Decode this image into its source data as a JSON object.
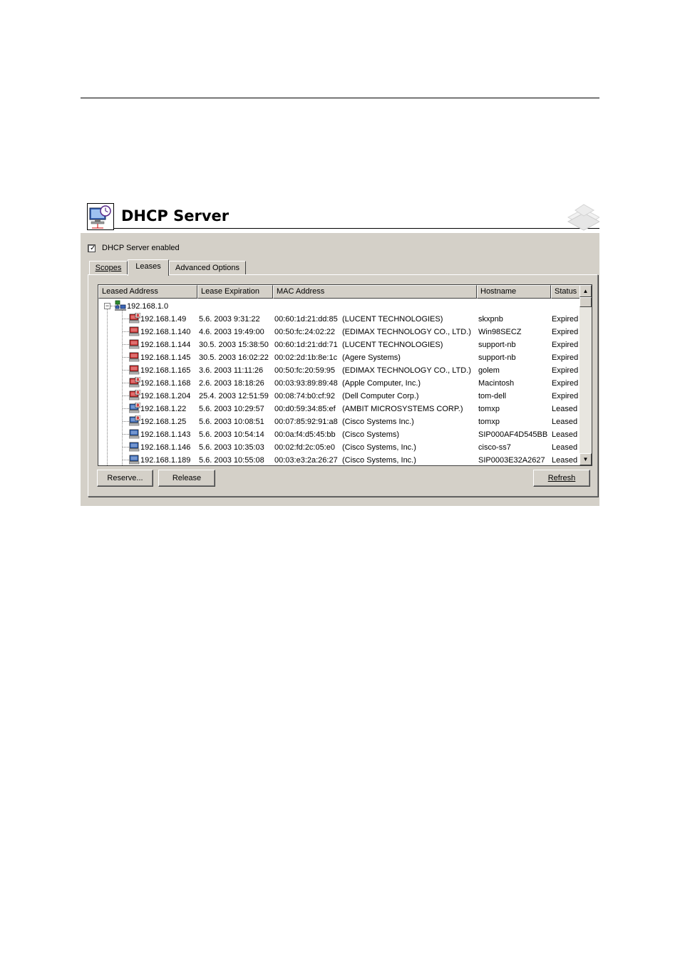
{
  "window": {
    "title": "DHCP Server"
  },
  "server_enabled": {
    "label": "DHCP Server enabled",
    "checked": true
  },
  "tabs": [
    {
      "label": "Scopes",
      "active": false
    },
    {
      "label": "Leases",
      "active": true
    },
    {
      "label": "Advanced Options",
      "active": false
    }
  ],
  "columns": [
    "Leased Address",
    "Lease Expiration",
    "MAC Address",
    "Hostname",
    "Status"
  ],
  "scope": {
    "label": "192.168.1.0"
  },
  "rows": [
    {
      "address": "192.168.1.49",
      "expiration": "5.6. 2003 9:31:22",
      "mac": "00:60:1d:21:dd:85",
      "vendor": "(LUCENT TECHNOLOGIES)",
      "hostname": "skxpnb",
      "status": "Expired",
      "reserved": true
    },
    {
      "address": "192.168.1.140",
      "expiration": "4.6. 2003 19:49:00",
      "mac": "00:50:fc:24:02:22",
      "vendor": "(EDIMAX TECHNOLOGY CO., LTD.)",
      "hostname": "Win98SECZ",
      "status": "Expired",
      "reserved": false
    },
    {
      "address": "192.168.1.144",
      "expiration": "30.5. 2003 15:38:50",
      "mac": "00:60:1d:21:dd:71",
      "vendor": "(LUCENT TECHNOLOGIES)",
      "hostname": "support-nb",
      "status": "Expired",
      "reserved": false
    },
    {
      "address": "192.168.1.145",
      "expiration": "30.5. 2003 16:02:22",
      "mac": "00:02:2d:1b:8e:1c",
      "vendor": "(Agere Systems)",
      "hostname": "support-nb",
      "status": "Expired",
      "reserved": false
    },
    {
      "address": "192.168.1.165",
      "expiration": "3.6. 2003 11:11:26",
      "mac": "00:50:fc:20:59:95",
      "vendor": "(EDIMAX TECHNOLOGY CO., LTD.)",
      "hostname": "golem",
      "status": "Expired",
      "reserved": false
    },
    {
      "address": "192.168.1.168",
      "expiration": "2.6. 2003 18:18:26",
      "mac": "00:03:93:89:89:48",
      "vendor": "(Apple Computer, Inc.)",
      "hostname": "Macintosh",
      "status": "Expired",
      "reserved": true
    },
    {
      "address": "192.168.1.204",
      "expiration": "25.4. 2003 12:51:59",
      "mac": "00:08:74:b0:cf:92",
      "vendor": "(Dell Computer Corp.)",
      "hostname": "tom-dell",
      "status": "Expired",
      "reserved": true
    },
    {
      "address": "192.168.1.22",
      "expiration": "5.6. 2003 10:29:57",
      "mac": "00:d0:59:34:85:ef",
      "vendor": "(AMBIT MICROSYSTEMS CORP.)",
      "hostname": "tomxp",
      "status": "Leased",
      "reserved": true
    },
    {
      "address": "192.168.1.25",
      "expiration": "5.6. 2003 10:08:51",
      "mac": "00:07:85:92:91:a8",
      "vendor": "(Cisco Systems Inc.)",
      "hostname": "tomxp",
      "status": "Leased",
      "reserved": true
    },
    {
      "address": "192.168.1.143",
      "expiration": "5.6. 2003 10:54:14",
      "mac": "00:0a:f4:d5:45:bb",
      "vendor": "(Cisco Systems)",
      "hostname": "SIP000AF4D545BB",
      "status": "Leased",
      "reserved": false
    },
    {
      "address": "192.168.1.146",
      "expiration": "5.6. 2003 10:35:03",
      "mac": "00:02:fd:2c:05:e0",
      "vendor": "(Cisco Systems, Inc.)",
      "hostname": "cisco-ss7",
      "status": "Leased",
      "reserved": false
    },
    {
      "address": "192.168.1.189",
      "expiration": "5.6. 2003 10:55:08",
      "mac": "00:03:e3:2a:26:27",
      "vendor": "(Cisco Systems, Inc.)",
      "hostname": "SIP0003E32A2627",
      "status": "Leased",
      "reserved": false
    }
  ],
  "buttons": {
    "reserve": "Reserve...",
    "release": "Release",
    "refresh": "Refresh"
  },
  "colors": {
    "expired": "#cc2222",
    "leased": "#2a5fb5",
    "panel": "#d4d0c8"
  }
}
